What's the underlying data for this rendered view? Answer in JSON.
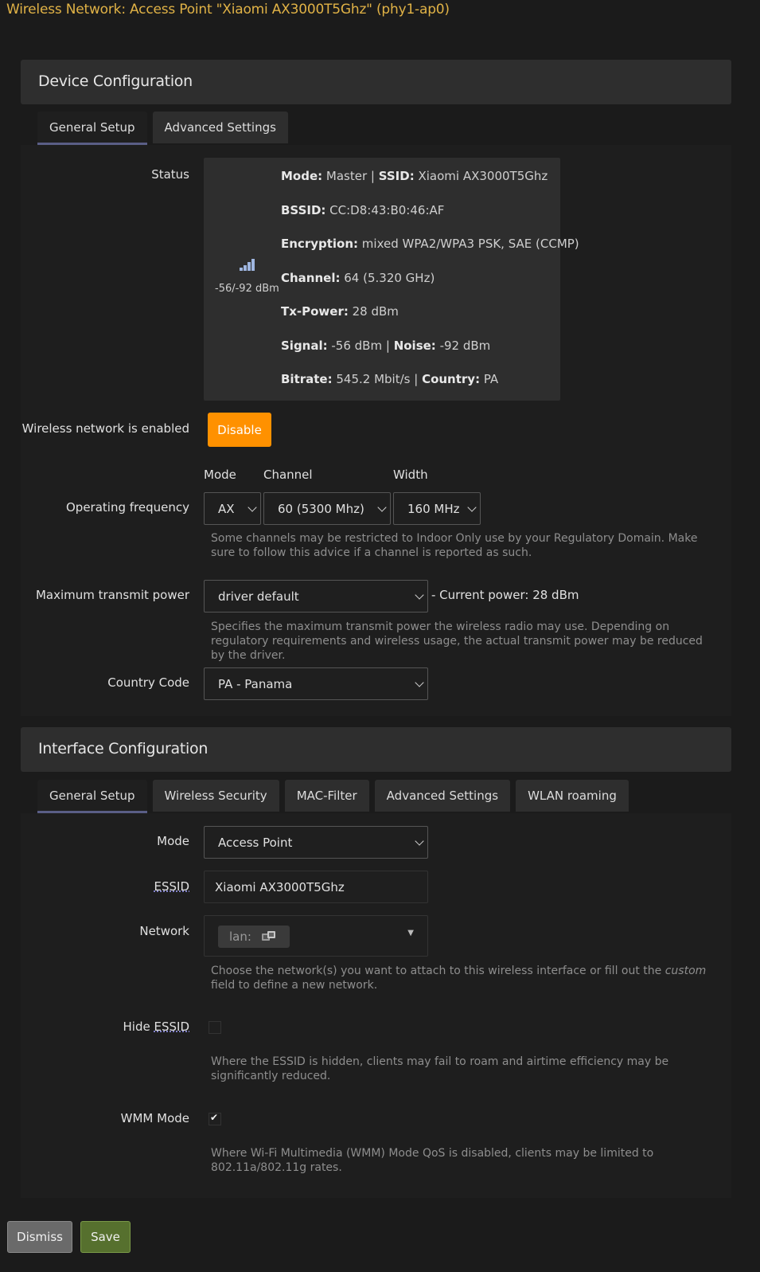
{
  "page": {
    "title": "Wireless Network: Access Point \"Xiaomi AX3000T5Ghz\" (phy1-ap0)"
  },
  "device": {
    "header": "Device Configuration",
    "tabs": [
      "General Setup",
      "Advanced Settings"
    ],
    "status": {
      "label": "Status",
      "signal_text": "-56/-92 dBm",
      "lines": [
        {
          "k1": "Mode:",
          "v1": " Master | ",
          "k2": "SSID:",
          "v2": " Xiaomi AX3000T5Ghz"
        },
        {
          "k1": "BSSID:",
          "v1": " CC:D8:43:B0:46:AF",
          "k2": "",
          "v2": ""
        },
        {
          "k1": "Encryption:",
          "v1": " mixed WPA2/WPA3 PSK, SAE (CCMP)",
          "k2": "",
          "v2": ""
        },
        {
          "k1": "Channel:",
          "v1": " 64 (5.320 GHz)",
          "k2": "",
          "v2": ""
        },
        {
          "k1": "Tx-Power:",
          "v1": " 28 dBm",
          "k2": "",
          "v2": ""
        },
        {
          "k1": "Signal:",
          "v1": " -56 dBm | ",
          "k2": "Noise:",
          "v2": " -92 dBm"
        },
        {
          "k1": "Bitrate:",
          "v1": " 545.2 Mbit/s | ",
          "k2": "Country:",
          "v2": " PA"
        }
      ]
    },
    "enabled": {
      "label": "Wireless network is enabled",
      "button": "Disable"
    },
    "frequency": {
      "label": "Operating frequency",
      "col_mode": "Mode",
      "col_channel": "Channel",
      "col_width": "Width",
      "mode": "AX",
      "channel": "60 (5300 Mhz)",
      "width": "160 MHz",
      "help": "Some channels may be restricted to Indoor Only use by your Regulatory Domain. Make sure to follow this advice if a channel is reported as such."
    },
    "txpower": {
      "label": "Maximum transmit power",
      "value": "driver default",
      "current": "- Current power: 28 dBm",
      "help": "Specifies the maximum transmit power the wireless radio may use. Depending on regulatory requirements and wireless usage, the actual transmit power may be reduced by the driver."
    },
    "country": {
      "label": "Country Code",
      "value": "PA - Panama"
    }
  },
  "interface": {
    "header": "Interface Configuration",
    "tabs": [
      "General Setup",
      "Wireless Security",
      "MAC-Filter",
      "Advanced Settings",
      "WLAN roaming"
    ],
    "mode": {
      "label": "Mode",
      "value": "Access Point"
    },
    "essid": {
      "label": "ESSID",
      "value": "Xiaomi AX3000T5Ghz"
    },
    "network": {
      "label": "Network",
      "chip": "lan:",
      "help_before": "Choose the network(s) you want to attach to this wireless interface or fill out the ",
      "help_em": "custom",
      "help_after": " field to define a new network."
    },
    "hide_essid": {
      "label_prefix": "Hide ",
      "label_abbr": "ESSID",
      "checked": false,
      "help": "Where the ESSID is hidden, clients may fail to roam and airtime efficiency may be significantly reduced."
    },
    "wmm": {
      "label": "WMM Mode",
      "checked": true,
      "check_glyph": "✔",
      "help": "Where Wi-Fi Multimedia (WMM) Mode QoS is disabled, clients may be limited to 802.11a/802.11g rates."
    }
  },
  "footer": {
    "dismiss": "Dismiss",
    "save": "Save"
  },
  "colors": {
    "title": "#e0b246",
    "disable_button": "#ff9100",
    "save_button": "#56702e",
    "dismiss_button": "#6a6a6a",
    "tab_underline": "#5a5e86"
  }
}
